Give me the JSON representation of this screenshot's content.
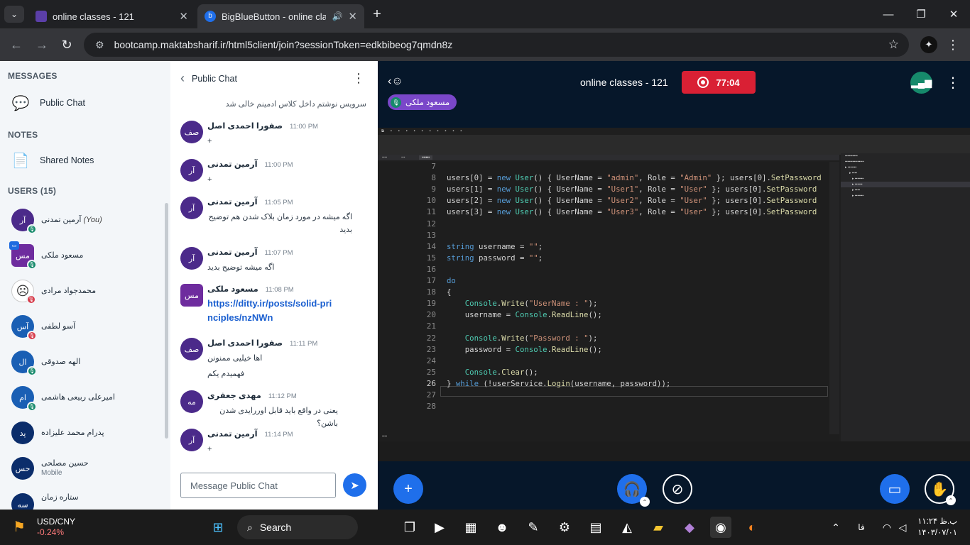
{
  "browser": {
    "tabs": [
      {
        "title": "online classes - 121"
      },
      {
        "title": "BigBlueButton - online class"
      }
    ],
    "url_domain": "bootcamp.maktabsharif.ir",
    "url_path": "/html5client/join?sessionToken=edkbibeog7qmdn8z"
  },
  "sidebar": {
    "messages_heading": "MESSAGES",
    "public_chat": "Public Chat",
    "notes_heading": "NOTES",
    "shared_notes": "Shared Notes",
    "users_heading": "USERS (15)",
    "users": [
      {
        "initials": "آر",
        "name": "آرمین تمدنی",
        "suffix": "(You)",
        "status": "mic-on"
      },
      {
        "initials": "مس",
        "name": "مسعود ملکی",
        "suffix": "",
        "status": "mic-on"
      },
      {
        "initials": "☹",
        "name": "محمدجواد مرادی",
        "suffix": "",
        "status": "mic-off"
      },
      {
        "initials": "آس",
        "name": "آسو لطفی",
        "suffix": "",
        "status": "mic-off"
      },
      {
        "initials": "ال",
        "name": "الهه صدوقی",
        "suffix": "",
        "status": "mic-on"
      },
      {
        "initials": "ام",
        "name": "امیرعلی ربیعی هاشمی",
        "suffix": "",
        "status": "mic-on"
      },
      {
        "initials": "پد",
        "name": "پدرام محمد علیزاده",
        "suffix": "",
        "status": ""
      },
      {
        "initials": "حس",
        "name": "حسین مصلحی",
        "suffix": "Mobile",
        "status": ""
      },
      {
        "initials": "سه",
        "name": "ستاره زمان",
        "suffix": "",
        "status": ""
      }
    ]
  },
  "chat": {
    "title": "Public Chat",
    "top_text": "سرویس نوشتم داخل کلاس ادمینم خالی شد",
    "messages": [
      {
        "initials": "صف",
        "name": "صفورا احمدی اصل",
        "time": "11:00 PM",
        "lines": [
          "+"
        ]
      },
      {
        "initials": "آر",
        "name": "آرمین تمدنی",
        "time": "11:00 PM",
        "lines": [
          "+"
        ]
      },
      {
        "initials": "آر",
        "name": "آرمین تمدنی",
        "time": "11:05 PM",
        "lines": [
          "اگه میشه در مورد زمان بلاک شدن هم توضیح بدید"
        ]
      },
      {
        "initials": "آر",
        "name": "آرمین تمدنی",
        "time": "11:07 PM",
        "lines": [
          "اگه میشه توضیح بدید"
        ]
      },
      {
        "initials": "مس",
        "name": "مسعود ملکی",
        "time": "11:08 PM",
        "link": "https://ditty.ir/posts/solid-principles/nzNWn"
      },
      {
        "initials": "صف",
        "name": "صفورا احمدی اصل",
        "time": "11:11 PM",
        "lines": [
          "اها خیلیی ممنونن",
          "فهمیدم یکم"
        ]
      },
      {
        "initials": "مه",
        "name": "مهدی جعفری",
        "time": "11:12 PM",
        "lines": [
          "یعنی در واقع باید قابل اوررایدی شدن باشن؟"
        ]
      },
      {
        "initials": "آر",
        "name": "آرمین تمدنی",
        "time": "11:14 PM",
        "lines": [
          "+"
        ]
      }
    ],
    "placeholder": "Message Public Chat"
  },
  "meeting": {
    "title": "online classes - 121",
    "timer": "77:04",
    "presenter": "مسعود ملکی"
  },
  "code": {
    "lines": [
      {
        "n": "7",
        "t": ""
      },
      {
        "n": "8",
        "t": "users[0] = new User() { UserName = \"admin\", Role = \"Admin\" }; users[0].SetPassword"
      },
      {
        "n": "9",
        "t": "users[1] = new User() { UserName = \"User1\", Role = \"User\" }; users[0].SetPassword"
      },
      {
        "n": "10",
        "t": "users[2] = new User() { UserName = \"User2\", Role = \"User\" }; users[0].SetPassword"
      },
      {
        "n": "11",
        "t": "users[3] = new User() { UserName = \"User3\", Role = \"User\" }; users[0].SetPassword"
      },
      {
        "n": "12",
        "t": ""
      },
      {
        "n": "13",
        "t": ""
      },
      {
        "n": "14",
        "t": "string username = \"\";"
      },
      {
        "n": "15",
        "t": "string password = \"\";"
      },
      {
        "n": "16",
        "t": ""
      },
      {
        "n": "17",
        "t": "do"
      },
      {
        "n": "18",
        "t": "{"
      },
      {
        "n": "19",
        "t": "    Console.Write(\"UserName : \");"
      },
      {
        "n": "20",
        "t": "    username = Console.ReadLine();"
      },
      {
        "n": "21",
        "t": ""
      },
      {
        "n": "22",
        "t": "    Console.Write(\"Password : \");"
      },
      {
        "n": "23",
        "t": "    password = Console.ReadLine();"
      },
      {
        "n": "24",
        "t": ""
      },
      {
        "n": "25",
        "t": "    Console.Clear();"
      },
      {
        "n": "26",
        "t": "} while (!userService.Login(username, password));"
      },
      {
        "n": "27",
        "t": ""
      },
      {
        "n": "28",
        "t": ""
      }
    ]
  },
  "taskbar": {
    "stock_symbol": "USD/CNY",
    "stock_change": "-0.24%",
    "search": "Search",
    "lang": "فا",
    "time": "۱۱:۲۴ ب.ظ",
    "date": "۱۴۰۳/۰۷/۰۱"
  }
}
